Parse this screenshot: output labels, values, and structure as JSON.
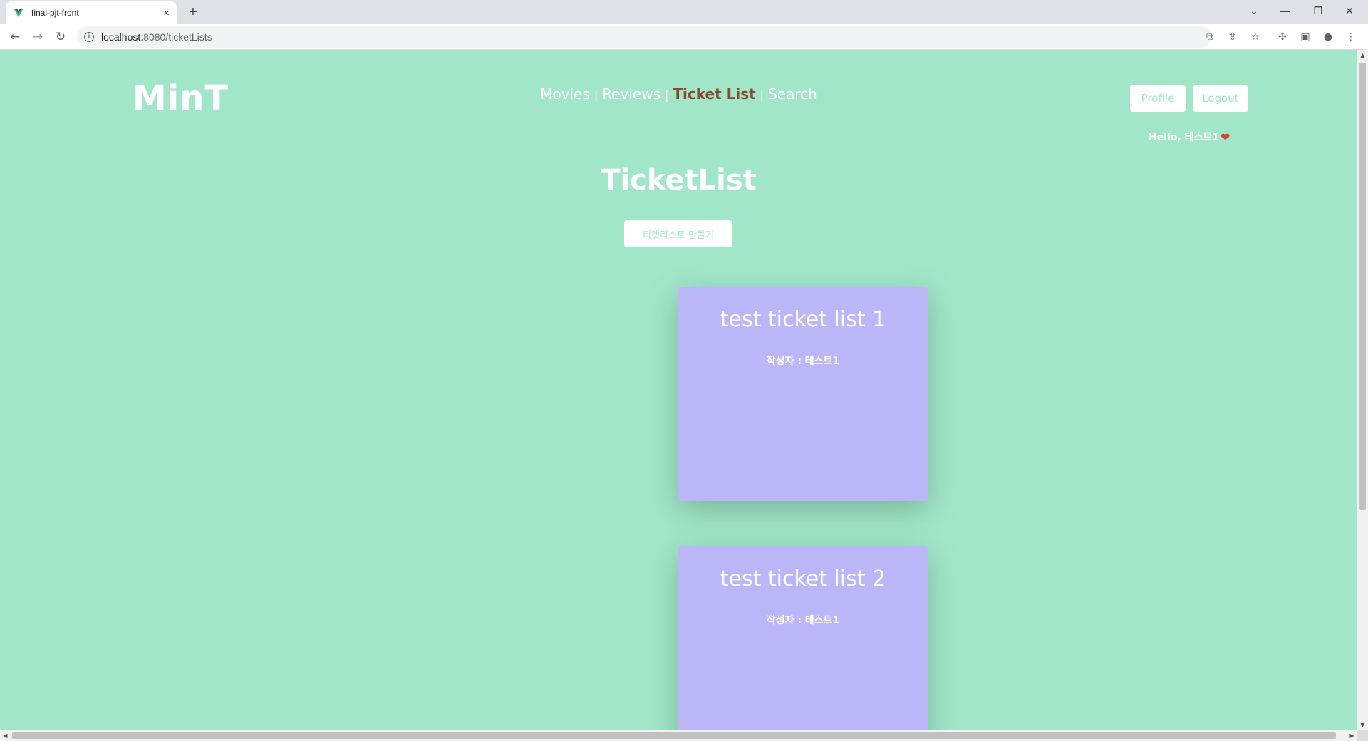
{
  "browser": {
    "tab_title": "final-pjt-front",
    "new_tab_icon": "+",
    "tab_close_icon": "×",
    "url_host": "localhost",
    "url_path": ":8080/ticketLists"
  },
  "nav": {
    "logo": "MinT",
    "items": [
      {
        "label": "Movies",
        "active": false
      },
      {
        "label": "Reviews",
        "active": false
      },
      {
        "label": "Ticket List",
        "active": true
      },
      {
        "label": "Search",
        "active": false
      }
    ],
    "separator": "|",
    "profile_label": "Profile",
    "logout_label": "Logout",
    "hello_text": "Hello, 테스트1",
    "heart": "❤"
  },
  "page": {
    "title": "TicketList",
    "create_button_label": "티켓리스트 만들기"
  },
  "ticket_lists": [
    {
      "title": "test ticket list 1",
      "author": "작성자 : 테스트1"
    },
    {
      "title": "test ticket list 2",
      "author": "작성자 : 테스트1"
    }
  ],
  "colors": {
    "background": "#a2e6c9",
    "card": "#bbb6f8",
    "active_nav": "#8b4a2e",
    "white": "#ffffff"
  }
}
